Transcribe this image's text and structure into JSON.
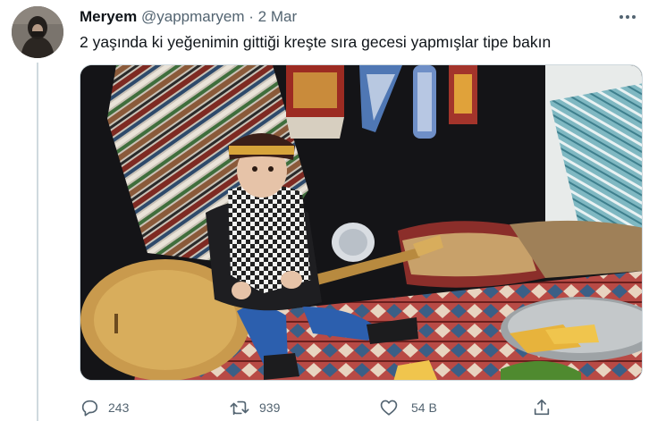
{
  "tweet": {
    "display_name": "Meryem",
    "handle": "@yappmaryem",
    "separator": "·",
    "date": "2 Mar",
    "text": "2 yaşında ki yeğenimin gittiği kreşte sıra gecesi yapmışlar tipe bakın",
    "actions": {
      "reply_count": "243",
      "retweet_count": "939",
      "like_count": "54 B"
    }
  },
  "icons": {
    "more": "more-dots-icon",
    "reply": "reply-icon",
    "retweet": "retweet-icon",
    "like": "heart-icon",
    "share": "share-icon"
  },
  "colors": {
    "text_primary": "#0f1419",
    "text_secondary": "#536471",
    "border": "#cfd9de"
  }
}
